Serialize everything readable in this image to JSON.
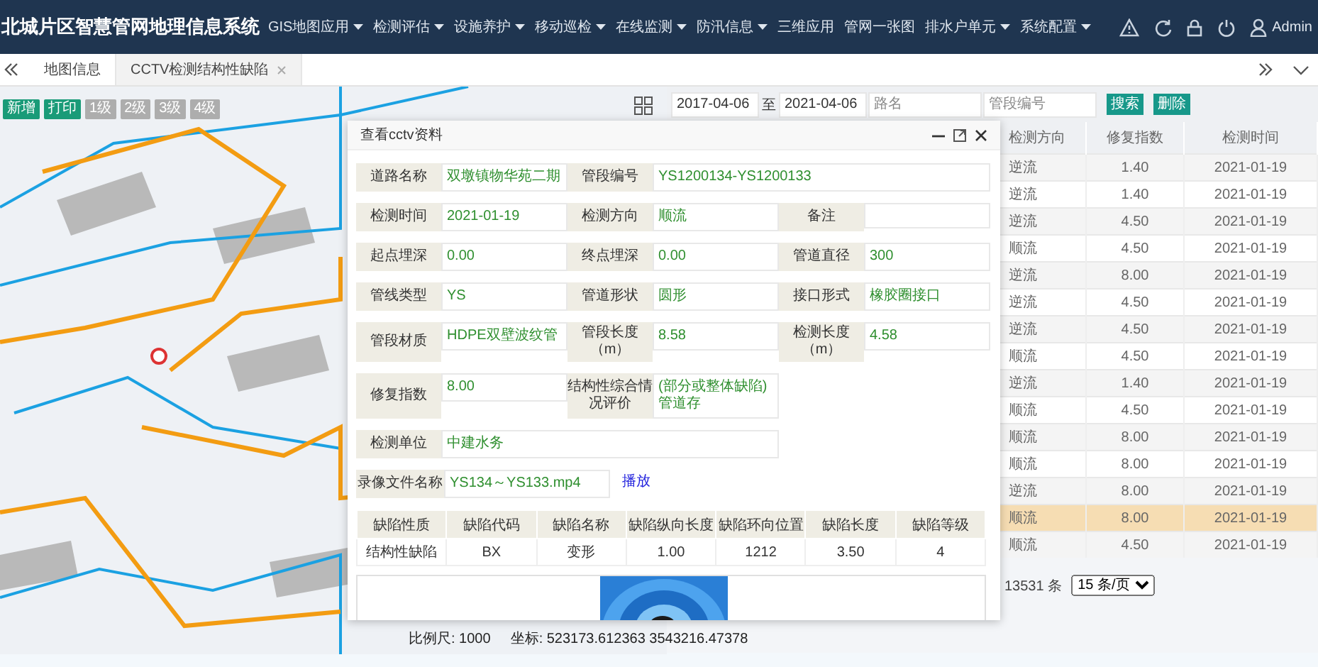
{
  "app": {
    "title": "北城片区智慧管网地理信息系统",
    "user": "Admin"
  },
  "menu": [
    {
      "label": "GIS地图应用",
      "dropdown": true
    },
    {
      "label": "检测评估",
      "dropdown": true
    },
    {
      "label": "设施养护",
      "dropdown": true
    },
    {
      "label": "移动巡检",
      "dropdown": true
    },
    {
      "label": "在线监测",
      "dropdown": true
    },
    {
      "label": "防汛信息",
      "dropdown": true
    },
    {
      "label": "三维应用",
      "dropdown": false
    },
    {
      "label": "管网一张图",
      "dropdown": false
    },
    {
      "label": "排水户单元",
      "dropdown": true
    },
    {
      "label": "系统配置",
      "dropdown": true
    }
  ],
  "tabs": [
    {
      "label": "地图信息",
      "selected": false,
      "closable": false
    },
    {
      "label": "CCTV检测结构性缺陷",
      "selected": true,
      "closable": true
    }
  ],
  "map_toolbar": [
    {
      "label": "新增",
      "kind": "primary"
    },
    {
      "label": "打印",
      "kind": "primary"
    },
    {
      "label": "1级",
      "kind": "level"
    },
    {
      "label": "2级",
      "kind": "level"
    },
    {
      "label": "3级",
      "kind": "level"
    },
    {
      "label": "4级",
      "kind": "level"
    }
  ],
  "map_status": {
    "scale": "比例尺: 1000",
    "coords": "坐标: 523173.612363 3543216.47378"
  },
  "filters": {
    "date_from": "2017-04-06",
    "separator": "至",
    "date_to": "2021-04-06",
    "road_placeholder": "路名",
    "pipe_placeholder": "管段编号",
    "buttons": [
      "搜索",
      "删除"
    ]
  },
  "table": {
    "columns": [
      "检测方向",
      "修复指数",
      "检测时间"
    ],
    "rows": [
      {
        "cells": [
          "逆流",
          "1.40",
          "2021-01-19"
        ],
        "selected": false
      },
      {
        "cells": [
          "逆流",
          "1.40",
          "2021-01-19"
        ],
        "selected": false
      },
      {
        "cells": [
          "逆流",
          "4.50",
          "2021-01-19"
        ],
        "selected": false
      },
      {
        "cells": [
          "顺流",
          "4.50",
          "2021-01-19"
        ],
        "selected": false
      },
      {
        "cells": [
          "逆流",
          "8.00",
          "2021-01-19"
        ],
        "selected": false
      },
      {
        "cells": [
          "逆流",
          "4.50",
          "2021-01-19"
        ],
        "selected": false
      },
      {
        "cells": [
          "逆流",
          "4.50",
          "2021-01-19"
        ],
        "selected": false
      },
      {
        "cells": [
          "顺流",
          "4.50",
          "2021-01-19"
        ],
        "selected": false
      },
      {
        "cells": [
          "逆流",
          "1.40",
          "2021-01-19"
        ],
        "selected": false
      },
      {
        "cells": [
          "顺流",
          "4.50",
          "2021-01-19"
        ],
        "selected": false
      },
      {
        "cells": [
          "顺流",
          "8.00",
          "2021-01-19"
        ],
        "selected": false
      },
      {
        "cells": [
          "顺流",
          "8.00",
          "2021-01-19"
        ],
        "selected": false
      },
      {
        "cells": [
          "逆流",
          "8.00",
          "2021-01-19"
        ],
        "selected": false
      },
      {
        "cells": [
          "顺流",
          "8.00",
          "2021-01-19"
        ],
        "selected": true
      },
      {
        "cells": [
          "顺流",
          "4.50",
          "2021-01-19"
        ],
        "selected": false
      }
    ]
  },
  "pagination": {
    "total": "13531 条",
    "page_size": "15 条/页"
  },
  "dialog": {
    "title": "查看cctv资料",
    "form_rows": [
      [
        {
          "label": "道路名称",
          "value": "双墩镇物华苑二期"
        },
        {
          "label": "管段编号",
          "value": "YS1200134-YS1200133",
          "wide": true
        }
      ],
      [
        {
          "label": "检测时间",
          "value": "2021-01-19"
        },
        {
          "label": "检测方向",
          "value": "顺流"
        },
        {
          "label": "备注"
        }
      ],
      [
        {
          "label": "起点埋深",
          "value": "0.00"
        },
        {
          "label": "终点埋深",
          "value": "0.00"
        },
        {
          "label": "管道直径",
          "value": "300"
        }
      ],
      [
        {
          "label": "管线类型",
          "value": "YS"
        },
        {
          "label": "管道形状",
          "value": "圆形"
        },
        {
          "label": "接口形式",
          "value": "橡胶圈接口"
        }
      ],
      [
        {
          "label": "管段材质",
          "value": "HDPE双壁波纹管"
        },
        {
          "label": "管段长度（m）",
          "value": "8.58"
        },
        {
          "label": "检测长度（m）",
          "value": "4.58"
        }
      ],
      [
        {
          "label": "修复指数",
          "value": "8.00"
        },
        {
          "label": "结构性综合情况评价",
          "value": "(部分或整体缺陷)管道存"
        }
      ],
      [
        {
          "label": "检测单位",
          "value": "中建水务",
          "wide": true
        }
      ],
      [
        {
          "label": "录像文件名称",
          "value": "YS134～YS133.mp4",
          "link": "播放"
        }
      ]
    ],
    "defects": {
      "columns": [
        "缺陷性质",
        "缺陷代码",
        "缺陷名称",
        "缺陷纵向长度",
        "缺陷环向位置",
        "缺陷长度",
        "缺陷等级"
      ],
      "rows": [
        [
          "结构性缺陷",
          "BX",
          "变形",
          "1.00",
          "1212",
          "3.50",
          "4"
        ]
      ]
    }
  }
}
